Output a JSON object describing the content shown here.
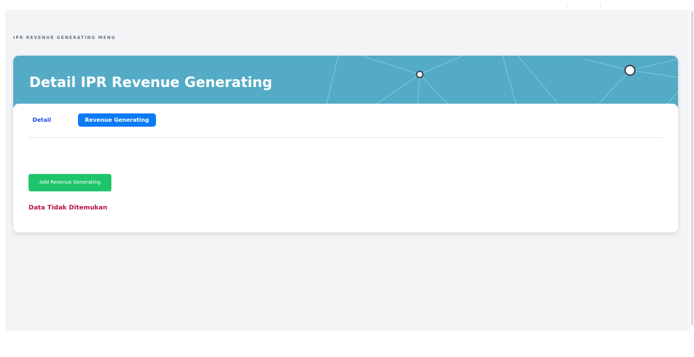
{
  "breadcrumb": "IPR REVENUE GENERATING MENU",
  "page_title": "Detail IPR Revenue Generating",
  "tabs": [
    {
      "label": "Detail",
      "active": false
    },
    {
      "label": "Revenue Generating",
      "active": true
    }
  ],
  "actions": {
    "add_label": "Add Revenue Generating"
  },
  "status": {
    "empty_message": "Data Tidak Ditemukan"
  },
  "colors": {
    "header": "#54abc6",
    "active_tab": "#0b7af5",
    "add_button": "#1ec46a",
    "empty_message": "#b5163f"
  },
  "icons": {
    "header_decoration": "network-lines-art"
  }
}
